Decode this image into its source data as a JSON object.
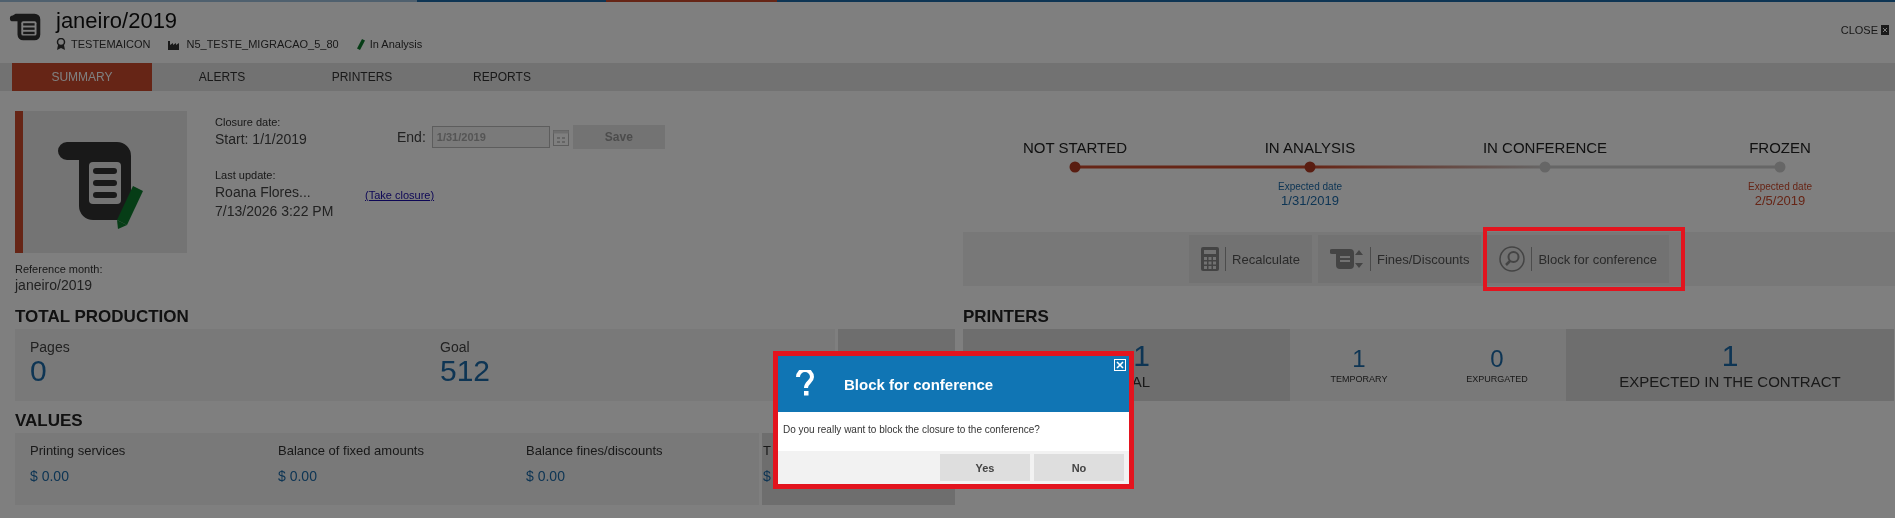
{
  "header": {
    "title": "janeiro/2019",
    "close": "CLOSE",
    "meta": [
      {
        "kind": "client",
        "text": "TESTEMAICON"
      },
      {
        "kind": "contract",
        "text": "N5_TESTE_MIGRACAO_5_80"
      },
      {
        "kind": "status",
        "text": "In Analysis"
      }
    ]
  },
  "tabs": [
    {
      "label": "SUMMARY",
      "selected": true
    },
    {
      "label": "ALERTS",
      "selected": false
    },
    {
      "label": "PRINTERS",
      "selected": false
    },
    {
      "label": "REPORTS",
      "selected": false
    }
  ],
  "summary": {
    "reference_label": "Reference month:",
    "reference_value": "janeiro/2019",
    "closure_label": "Closure date:",
    "start": "Start: 1/1/2019",
    "end_label": "End:",
    "end_value": "1/31/2019",
    "save": "Save",
    "last_update_label": "Last update:",
    "user": "Roana Flores...",
    "updated_at": "7/13/2026 3:22 PM",
    "take_closure": "(Take closure)"
  },
  "stepper": [
    {
      "label": "NOT STARTED",
      "reached": true
    },
    {
      "label": "IN ANALYSIS",
      "reached": true,
      "expected_label": "Expected date",
      "expected_date": "1/31/2019",
      "overdue": false
    },
    {
      "label": "IN CONFERENCE",
      "reached": false
    },
    {
      "label": "FROZEN",
      "reached": false,
      "expected_label": "Expected date",
      "expected_date": "2/5/2019",
      "overdue": true
    }
  ],
  "actions": [
    {
      "kind": "calculator",
      "label": "Recalculate",
      "highlighted": false
    },
    {
      "kind": "fines",
      "label": "Fines/Discounts",
      "highlighted": false
    },
    {
      "kind": "search",
      "label": "Block for conference",
      "highlighted": true
    }
  ],
  "total_production": {
    "title": "TOTAL PRODUCTION",
    "items": [
      {
        "label": "Pages",
        "value": "0"
      },
      {
        "label": "Goal",
        "value": "512"
      }
    ]
  },
  "printers": {
    "title": "PRINTERS",
    "items": [
      {
        "kind": "major",
        "value": "1",
        "label": "AL"
      },
      {
        "kind": "minor",
        "value": "1",
        "label": "TEMPORARY"
      },
      {
        "kind": "minor",
        "value": "0",
        "label": "EXPURGATED"
      },
      {
        "kind": "major",
        "value": "1",
        "label": "EXPECTED IN THE CONTRACT"
      }
    ]
  },
  "values": {
    "title": "VALUES",
    "items": [
      {
        "label": "Printing services",
        "value": "$ 0.00"
      },
      {
        "label": "Balance of fixed amounts",
        "value": "$ 0.00"
      },
      {
        "label": "Balance fines/discounts",
        "value": "$ 0.00"
      },
      {
        "label": "T",
        "value": "$"
      }
    ]
  },
  "dialog": {
    "title": "Block for conference",
    "message": "Do you really want to block the closure to the conference?",
    "buttons": [
      "Yes",
      "No"
    ],
    "highlighted": true
  }
}
